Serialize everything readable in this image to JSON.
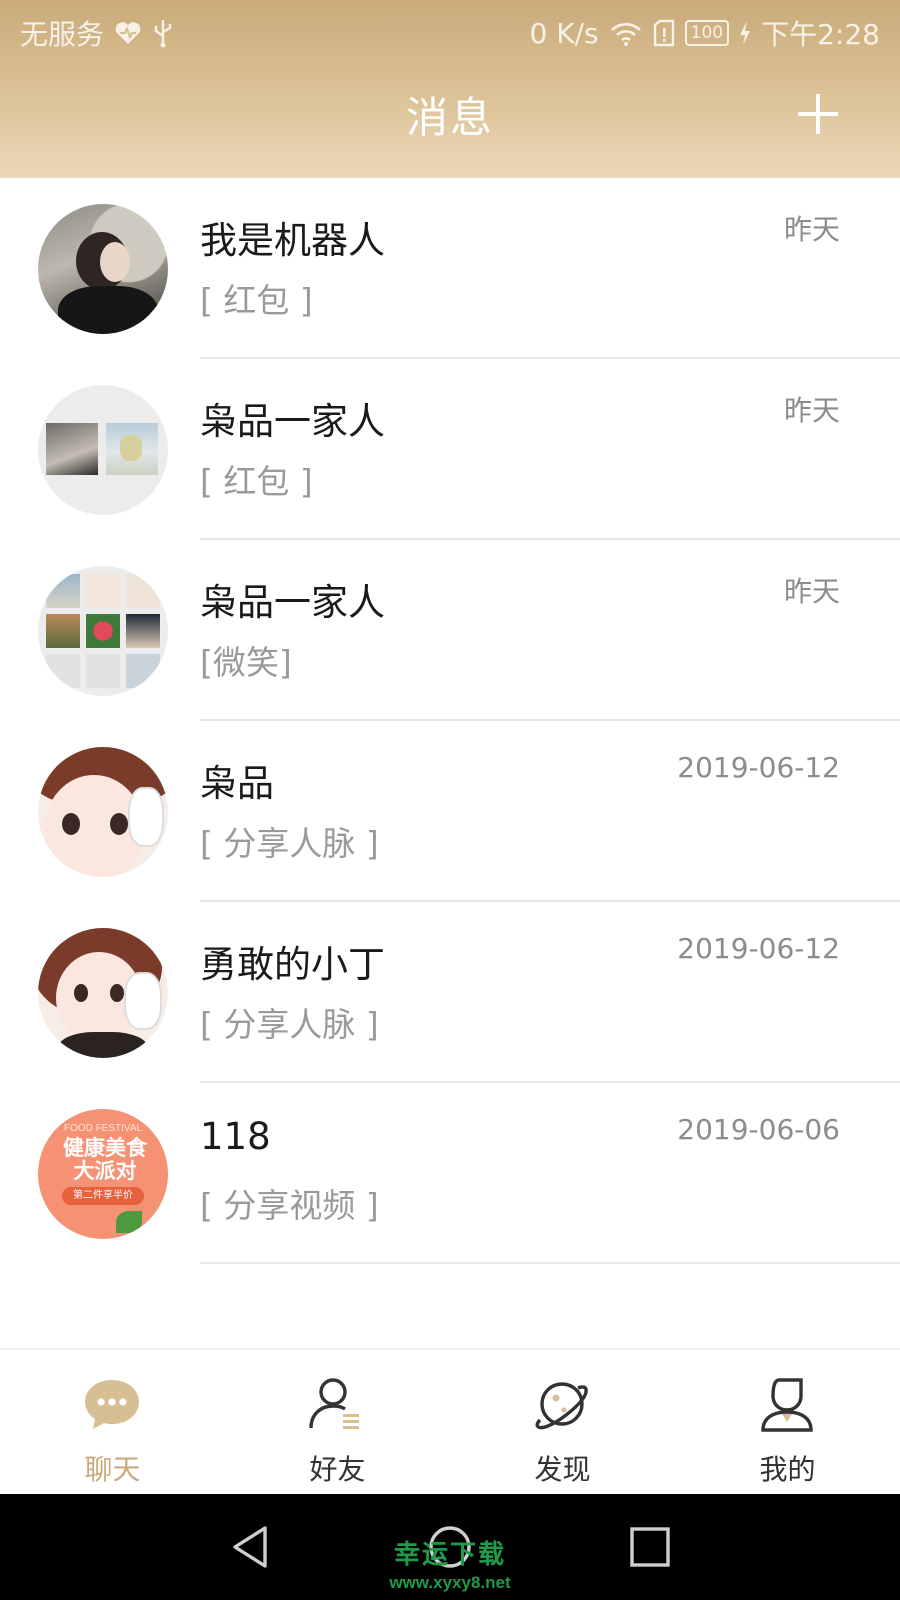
{
  "status_bar": {
    "carrier": "无服务",
    "network_speed": "0 K/s",
    "battery": "100",
    "time": "下午2:28",
    "icons": [
      "heart-icon",
      "usb-icon",
      "wifi-icon",
      "sim-icon",
      "battery-icon",
      "charging-icon"
    ]
  },
  "header": {
    "title": "消息",
    "add_icon": "plus-icon"
  },
  "conversations": [
    {
      "name": "我是机器人",
      "preview": "[ 红包 ]",
      "time": "昨天"
    },
    {
      "name": "枭品一家人",
      "preview": "[ 红包 ]",
      "time": "昨天"
    },
    {
      "name": "枭品一家人",
      "preview": "[微笑]",
      "time": "昨天"
    },
    {
      "name": "枭品",
      "preview": "[ 分享人脉 ]",
      "time": "2019-06-12"
    },
    {
      "name": "勇敢的小丁",
      "preview": "[ 分享人脉 ]",
      "time": "2019-06-12"
    },
    {
      "name": "118",
      "preview": "[ 分享视频 ]",
      "time": "2019-06-06"
    }
  ],
  "avatar6_text": {
    "small": "FOOD FESTIVAL",
    "big_line1": "健康美食",
    "big_line2": "大派对",
    "badge": "第二件享半价"
  },
  "tabs": [
    {
      "label": "聊天",
      "icon": "chat-bubble-icon",
      "active": true
    },
    {
      "label": "好友",
      "icon": "friends-icon",
      "active": false
    },
    {
      "label": "发现",
      "icon": "planet-icon",
      "active": false
    },
    {
      "label": "我的",
      "icon": "profile-icon",
      "active": false
    }
  ],
  "colors": {
    "accent": "#c9ab7a",
    "header_gradient_top": "#c9ab7a",
    "header_gradient_bottom": "#ead8b9",
    "text_primary": "#1a1a1a",
    "text_secondary": "#9a9a9a"
  },
  "nav_bar": {
    "back_icon": "back-triangle-icon",
    "home_icon": "home-circle-icon",
    "recents_icon": "recents-square-icon"
  },
  "watermark": {
    "line1": "幸运下载",
    "line2": "www.xyxy8.net"
  }
}
